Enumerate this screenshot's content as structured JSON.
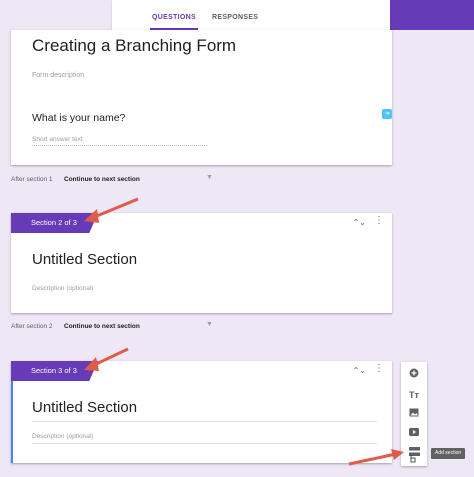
{
  "tabs": [
    {
      "label": "QUESTIONS"
    },
    {
      "label": "RESPONSES"
    }
  ],
  "form": {
    "title": "Creating a Branching Form",
    "description_placeholder": "Form description",
    "question": "What is your name?",
    "short_answer_placeholder": "Short answer text"
  },
  "after_sections": [
    {
      "label": "After section 1",
      "value": "Continue to next section"
    },
    {
      "label": "After section 2",
      "value": "Continue to next section"
    }
  ],
  "sections": [
    {
      "tab": "Section 2 of 3",
      "title": "Untitled Section",
      "description_placeholder": "Description (optional)"
    },
    {
      "tab": "Section 3 of 3",
      "title": "Untitled Section",
      "description_placeholder": "Description (optional)"
    }
  ],
  "toolbar": {
    "tooltip": "Add section",
    "icons": [
      "add-question-icon",
      "add-title-icon",
      "add-image-icon",
      "add-video-icon",
      "add-section-icon"
    ]
  },
  "colors": {
    "accent": "#673ab7",
    "background": "#ede7f6",
    "arrow": "#e15b4b"
  }
}
